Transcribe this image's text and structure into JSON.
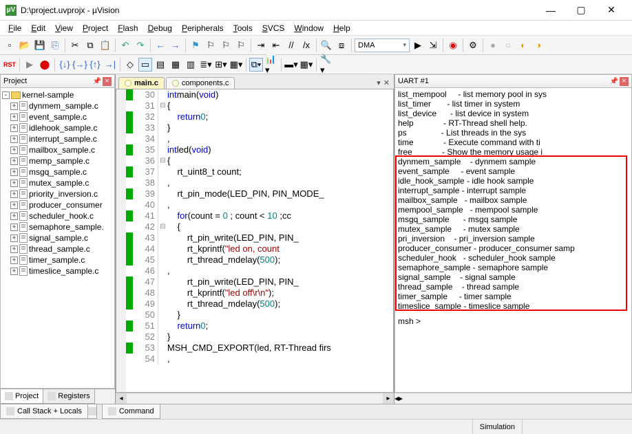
{
  "window": {
    "title": "D:\\project.uvprojx - µVision",
    "icon_label": "µV",
    "min": "—",
    "max": "▢",
    "close": "✕"
  },
  "menubar": [
    "File",
    "Edit",
    "View",
    "Project",
    "Flash",
    "Debug",
    "Peripherals",
    "Tools",
    "SVCS",
    "Window",
    "Help"
  ],
  "toolbar1": {
    "combo1": "DMA"
  },
  "project": {
    "title": "Project",
    "root": "kernel-sample",
    "files": [
      "dynmem_sample.c",
      "event_sample.c",
      "idlehook_sample.c",
      "interrupt_sample.c",
      "mailbox_sample.c",
      "memp_sample.c",
      "msgq_sample.c",
      "mutex_sample.c",
      "priority_inversion.c",
      "producer_consumer",
      "scheduler_hook.c",
      "semaphore_sample.",
      "signal_sample.c",
      "thread_sample.c",
      "timer_sample.c",
      "timeslice_sample.c"
    ],
    "tabs": [
      "Project",
      "Registers"
    ]
  },
  "editor": {
    "tabs": [
      "main.c",
      "components.c"
    ],
    "lines": [
      {
        "n": 30,
        "m": 1,
        "f": "",
        "t": "int main(void)",
        "seg": [
          [
            "kw",
            "int"
          ],
          [
            " "
          ],
          [
            "fn",
            "main"
          ],
          [
            "",
            "("
          ],
          [
            "kw",
            "void"
          ],
          [
            "",
            ")"
          ]
        ]
      },
      {
        "n": 31,
        "m": 0,
        "f": "⊟",
        "t": "{",
        "seg": [
          [
            "",
            "{"
          ]
        ]
      },
      {
        "n": 32,
        "m": 1,
        "f": "",
        "t": "    return 0;",
        "seg": [
          [
            "",
            "    "
          ],
          [
            "kw",
            "return"
          ],
          [
            " "
          ],
          [
            "num",
            "0"
          ],
          [
            "",
            ";"
          ]
        ]
      },
      {
        "n": 33,
        "m": 1,
        "f": "",
        "t": "}",
        "seg": [
          [
            "",
            "}"
          ]
        ]
      },
      {
        "n": 34,
        "m": 0,
        "f": "",
        "t": "",
        "seg": [
          [
            "",
            ""
          ]
        ]
      },
      {
        "n": 35,
        "m": 1,
        "f": "",
        "t": "int led(void)",
        "seg": [
          [
            "kw",
            "int"
          ],
          [
            " "
          ],
          [
            "fn",
            "led"
          ],
          [
            "",
            "("
          ],
          [
            "kw",
            "void"
          ],
          [
            "",
            ")"
          ]
        ]
      },
      {
        "n": 36,
        "m": 0,
        "f": "⊟",
        "t": "{",
        "seg": [
          [
            "",
            "{"
          ]
        ]
      },
      {
        "n": 37,
        "m": 1,
        "f": "",
        "t": "    rt_uint8_t count;",
        "seg": [
          [
            "",
            "    rt_uint8_t count;"
          ]
        ]
      },
      {
        "n": 38,
        "m": 0,
        "f": "",
        "t": "",
        "seg": [
          [
            "",
            ""
          ]
        ]
      },
      {
        "n": 39,
        "m": 1,
        "f": "",
        "t": "    rt_pin_mode(LED_PIN, PIN_MODE_",
        "seg": [
          [
            "",
            "    rt_pin_mode(LED_PIN, PIN_MODE_"
          ]
        ]
      },
      {
        "n": 40,
        "m": 0,
        "f": "",
        "t": "",
        "seg": [
          [
            "",
            ""
          ]
        ]
      },
      {
        "n": 41,
        "m": 1,
        "f": "",
        "t": "    for(count = 0 ; count < 10 ;cc",
        "seg": [
          [
            "",
            "    "
          ],
          [
            "kw",
            "for"
          ],
          [
            "",
            "(count = "
          ],
          [
            "num",
            "0"
          ],
          [
            "",
            " ; count < "
          ],
          [
            "num",
            "10"
          ],
          [
            "",
            " ;cc"
          ]
        ]
      },
      {
        "n": 42,
        "m": 0,
        "f": "⊟",
        "t": "    {",
        "seg": [
          [
            "",
            "    {"
          ]
        ]
      },
      {
        "n": 43,
        "m": 1,
        "f": "",
        "t": "        rt_pin_write(LED_PIN, PIN_",
        "seg": [
          [
            "",
            "        rt_pin_write(LED_PIN, PIN_"
          ]
        ]
      },
      {
        "n": 44,
        "m": 1,
        "f": "",
        "t": "        rt_kprintf(\"led on, count",
        "seg": [
          [
            "",
            "        rt_kprintf("
          ],
          [
            "str",
            "\"led on, count"
          ]
        ]
      },
      {
        "n": 45,
        "m": 1,
        "f": "",
        "t": "        rt_thread_mdelay(500);",
        "seg": [
          [
            "",
            "        rt_thread_mdelay("
          ],
          [
            "num",
            "500"
          ],
          [
            "",
            ");"
          ]
        ]
      },
      {
        "n": 46,
        "m": 0,
        "f": "",
        "t": "",
        "seg": [
          [
            "",
            ""
          ]
        ]
      },
      {
        "n": 47,
        "m": 1,
        "f": "",
        "t": "        rt_pin_write(LED_PIN, PIN_",
        "seg": [
          [
            "",
            "        rt_pin_write(LED_PIN, PIN_"
          ]
        ]
      },
      {
        "n": 48,
        "m": 1,
        "f": "",
        "t": "        rt_kprintf(\"led off\\r\\n\");",
        "seg": [
          [
            "",
            "        rt_kprintf("
          ],
          [
            "str",
            "\"led off\\r\\n\""
          ],
          [
            "",
            ");"
          ]
        ]
      },
      {
        "n": 49,
        "m": 1,
        "f": "",
        "t": "        rt_thread_mdelay(500);",
        "seg": [
          [
            "",
            "        rt_thread_mdelay("
          ],
          [
            "num",
            "500"
          ],
          [
            "",
            ");"
          ]
        ]
      },
      {
        "n": 50,
        "m": 0,
        "f": "",
        "t": "    }",
        "seg": [
          [
            "",
            "    }"
          ]
        ]
      },
      {
        "n": 51,
        "m": 1,
        "f": "",
        "t": "    return 0;",
        "seg": [
          [
            "",
            "    "
          ],
          [
            "kw",
            "return"
          ],
          [
            " "
          ],
          [
            "num",
            "0"
          ],
          [
            "",
            ";"
          ]
        ]
      },
      {
        "n": 52,
        "m": 0,
        "f": "",
        "t": "}",
        "seg": [
          [
            "",
            "}"
          ]
        ]
      },
      {
        "n": 53,
        "m": 1,
        "f": "",
        "t": "MSH_CMD_EXPORT(led, RT-Thread firs",
        "seg": [
          [
            "",
            "MSH_CMD_EXPORT(led, RT-Thread firs"
          ]
        ]
      },
      {
        "n": 54,
        "m": 0,
        "f": "",
        "t": "",
        "seg": [
          [
            "",
            ""
          ]
        ]
      }
    ]
  },
  "uart": {
    "title": "UART #1",
    "top_lines": [
      "list_mempool     - list memory pool in sys",
      "list_timer       - list timer in system",
      "list_device      - list device in system",
      "help             - RT-Thread shell help.",
      "ps               - List threads in the sys",
      "time             - Execute command with ti",
      "free             - Show the memory usage i"
    ],
    "box_lines": [
      "dynmem_sample    - dynmem sample",
      "event_sample     - event sample",
      "idle_hook_sample - idle hook sample",
      "interrupt_sample - interrupt sample",
      "mailbox_sample   - mailbox sample",
      "mempool_sample   - mempool sample",
      "msgq_sample      - msgq sample",
      "mutex_sample     - mutex sample",
      "pri_inversion    - pri_inversion sample",
      "producer_consumer - producer_consumer samp",
      "scheduler_hook   - scheduler_hook sample",
      "semaphore_sample - semaphore sample",
      "signal_sample    - signal sample",
      "thread_sample    - thread sample",
      "timer_sample     - timer sample",
      "timeslice_sample - timeslice sample"
    ],
    "prompt": "msh >"
  },
  "bottom_tabs": {
    "left": [
      "Call Stack + Locals"
    ],
    "mid": [
      "Command"
    ]
  },
  "status": {
    "sim": "Simulation"
  }
}
